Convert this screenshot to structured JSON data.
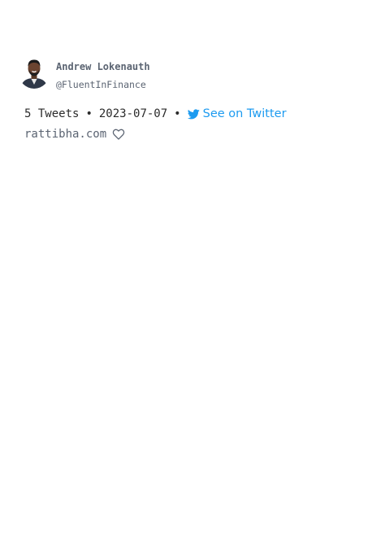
{
  "author": {
    "name": "Andrew Lokenauth",
    "handle": "@FluentInFinance"
  },
  "thread": {
    "tweet_count": "5 Tweets",
    "separator": "•",
    "date": "2023-07-07",
    "twitter_link_label": "See on Twitter",
    "twitter_icon": "twitter-bird-icon"
  },
  "site": {
    "domain": "rattibha.com",
    "favorite_icon": "heart-icon"
  },
  "colors": {
    "link": "#1d9bf0",
    "muted_text": "#5b6472",
    "body_text": "#2b2b2b"
  }
}
